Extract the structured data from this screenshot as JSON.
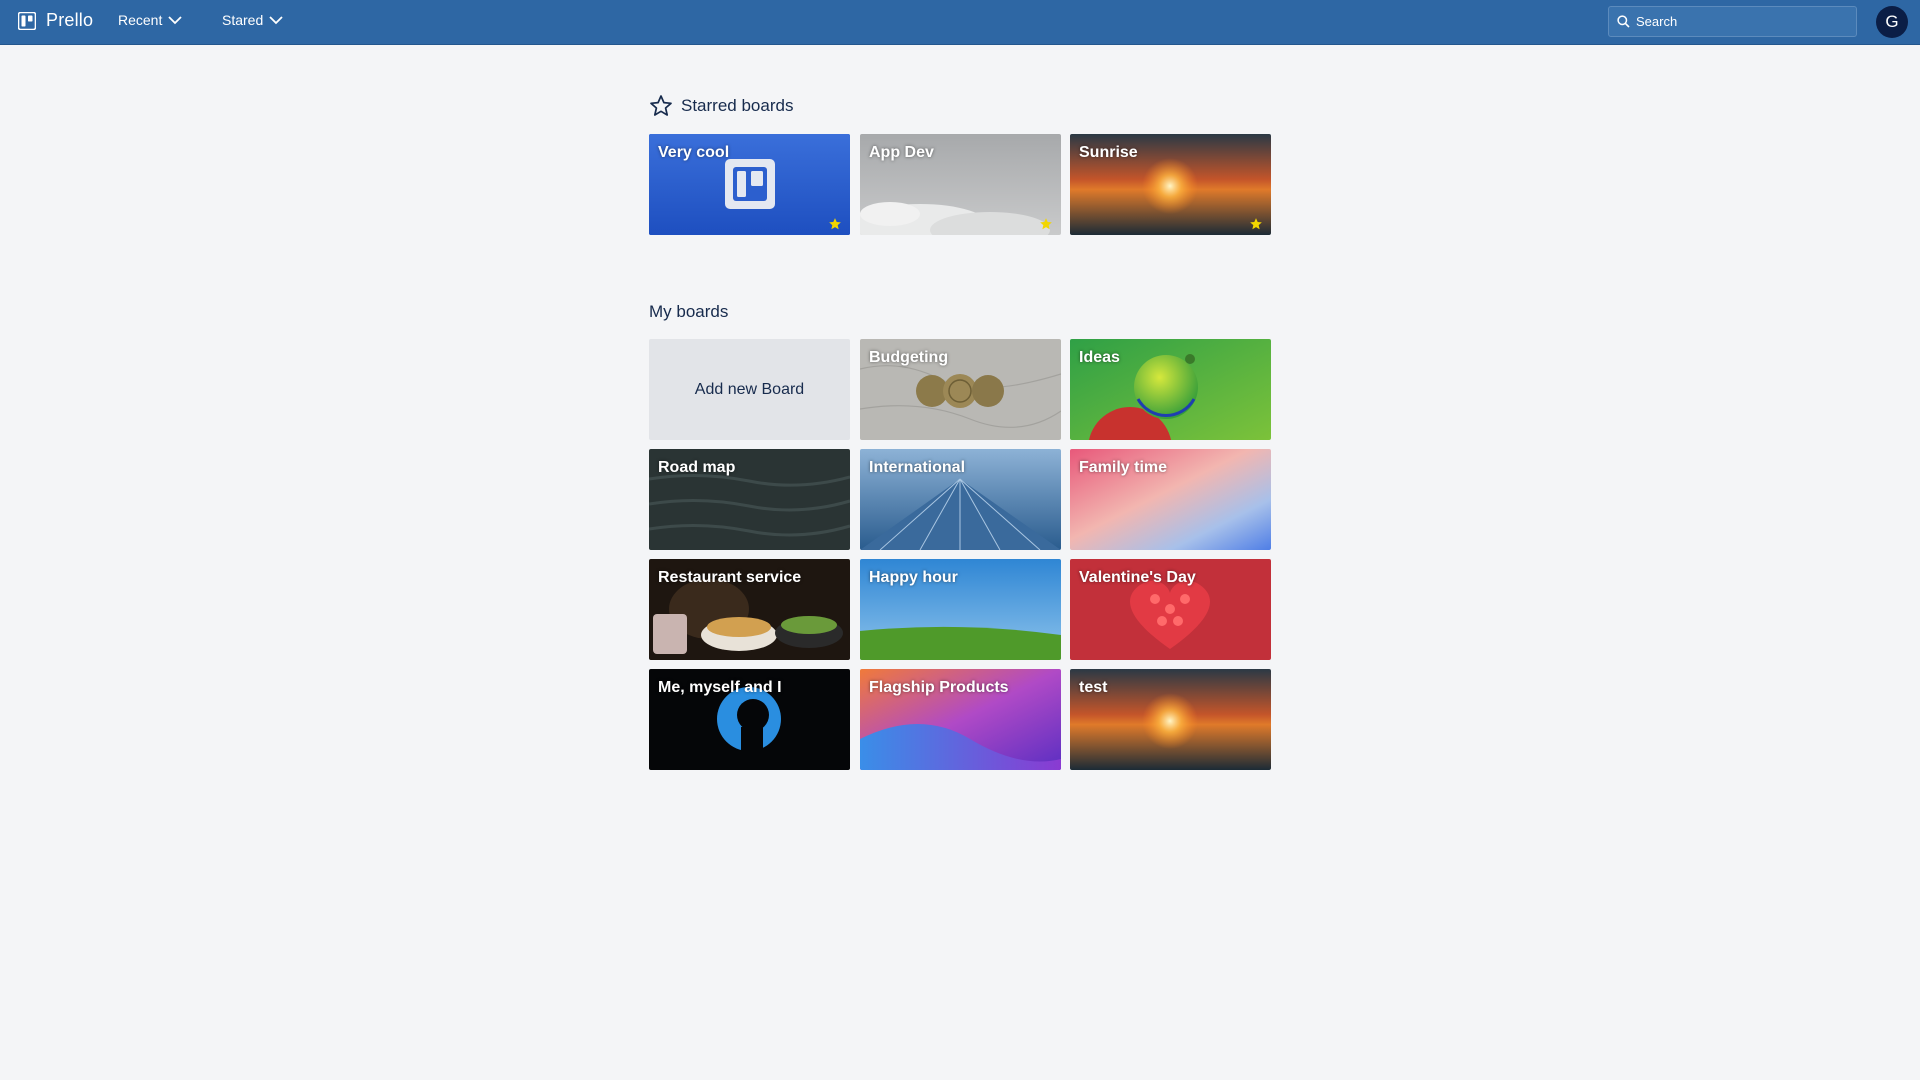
{
  "app": {
    "name": "Prello"
  },
  "nav": {
    "recent_label": "Recent",
    "stared_label": "Stared",
    "search_placeholder": "Search",
    "avatar_initial": "G"
  },
  "starred": {
    "heading": "Starred boards",
    "boards": [
      {
        "title": "Very cool",
        "background": "prello-logo-blue",
        "starred": true
      },
      {
        "title": "App Dev",
        "background": "grey-clouds",
        "starred": true
      },
      {
        "title": "Sunrise",
        "background": "sunset-sea",
        "starred": true
      }
    ]
  },
  "my_boards": {
    "heading": "My boards",
    "add_label": "Add new Board",
    "boards": [
      {
        "title": "Budgeting",
        "background": "coins-on-stone"
      },
      {
        "title": "Ideas",
        "background": "green-red-spheres"
      },
      {
        "title": "Road map",
        "background": "dark-water"
      },
      {
        "title": "International",
        "background": "blue-building"
      },
      {
        "title": "Family time",
        "background": "pastel-gradient"
      },
      {
        "title": "Restaurant service",
        "background": "food-bowls"
      },
      {
        "title": "Happy hour",
        "background": "green-hill-blue-sky"
      },
      {
        "title": "Valentine's Day",
        "background": "red-heart"
      },
      {
        "title": "Me, myself and I",
        "background": "silhouette-black"
      },
      {
        "title": "Flagship Products",
        "background": "purple-wave"
      },
      {
        "title": "test",
        "background": "sunset-sea"
      }
    ]
  },
  "colors": {
    "topbar": "#2e67a4",
    "page_bg": "#f4f5f7",
    "star_gold": "#f2d600",
    "avatar_bg": "#0b1e46"
  }
}
